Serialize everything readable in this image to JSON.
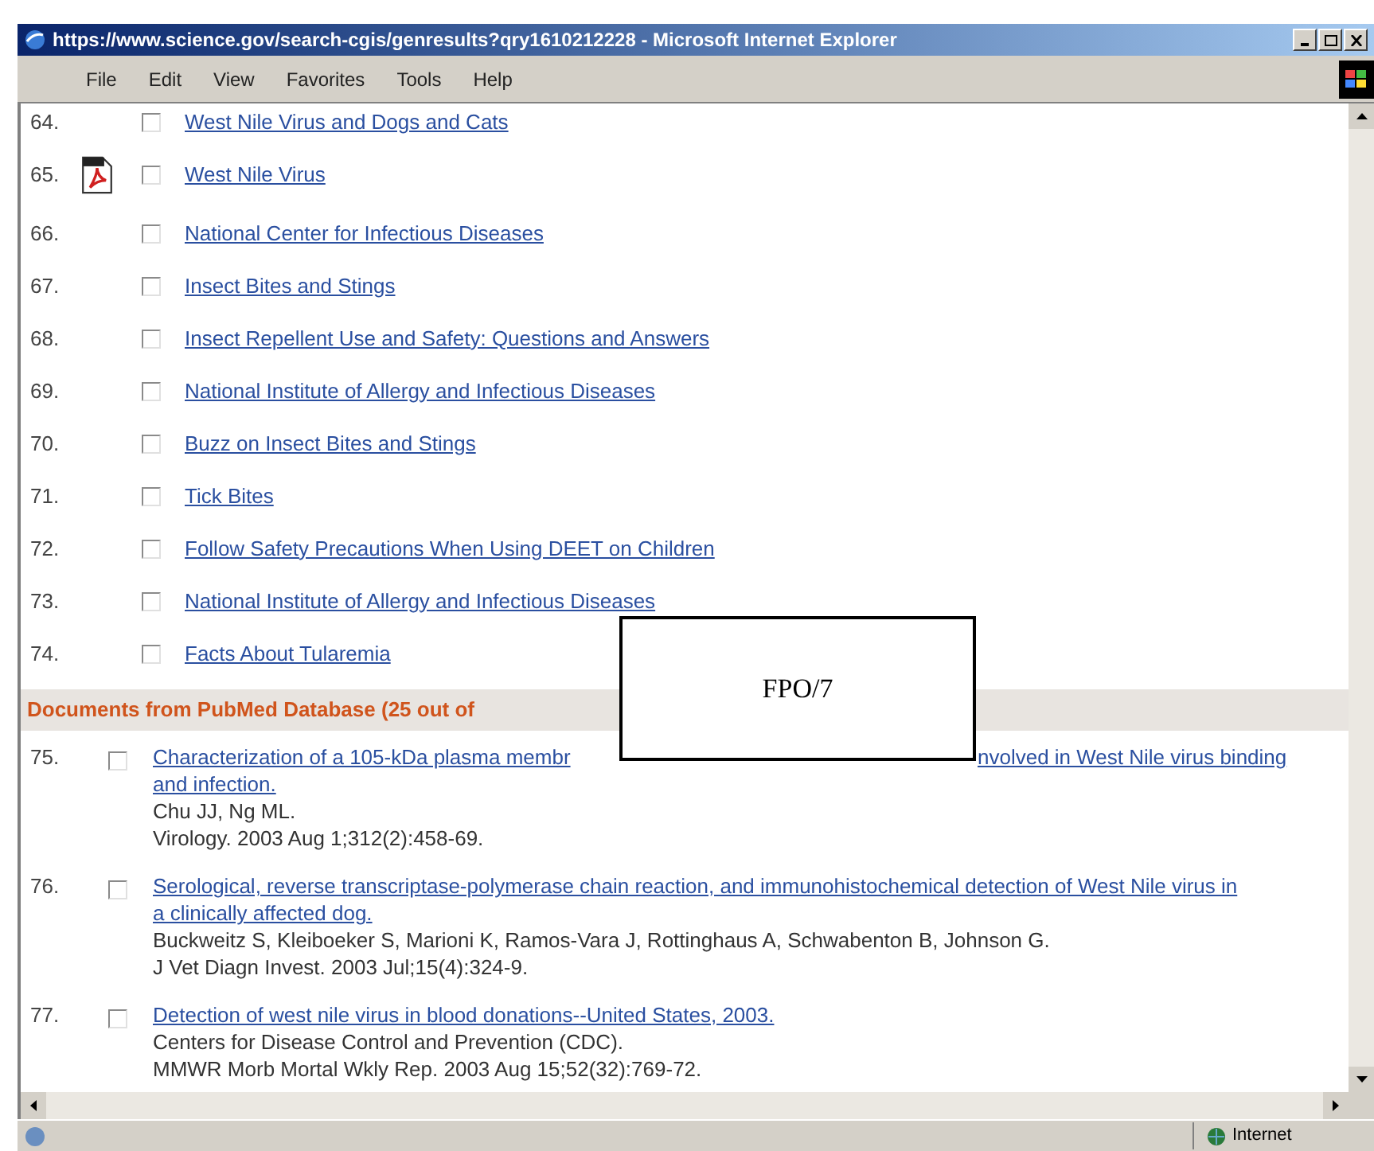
{
  "window": {
    "title": "https://www.science.gov/search-cgis/genresults?qry1610212228 - Microsoft Internet Explorer"
  },
  "menu": [
    "File",
    "Edit",
    "View",
    "Favorites",
    "Tools",
    "Help"
  ],
  "results": [
    {
      "number": "64.",
      "kind": "web",
      "title": "West Nile Virus and Dogs and Cats",
      "checked": false
    },
    {
      "number": "65.",
      "kind": "pdf",
      "title": "West Nile Virus",
      "checked": false
    },
    {
      "number": "66.",
      "kind": "web",
      "title": "National Center for Infectious Diseases",
      "checked": false
    },
    {
      "number": "67.",
      "kind": "web",
      "title": "Insect Bites and Stings",
      "checked": false
    },
    {
      "number": "68.",
      "kind": "web",
      "title": "Insect Repellent Use and Safety: Questions and Answers",
      "checked": false
    },
    {
      "number": "69.",
      "kind": "web",
      "title": "National Institute of Allergy and Infectious Diseases",
      "checked": false
    },
    {
      "number": "70.",
      "kind": "web",
      "title": "Buzz on Insect Bites and Stings",
      "checked": false
    },
    {
      "number": "71.",
      "kind": "web",
      "title": "Tick Bites",
      "checked": false
    },
    {
      "number": "72.",
      "kind": "web",
      "title": "Follow Safety Precautions When Using DEET on Children",
      "checked": false
    },
    {
      "number": "73.",
      "kind": "web",
      "title": "National Institute of Allergy and Infectious Diseases",
      "checked": false
    },
    {
      "number": "74.",
      "kind": "web",
      "title": "Facts About Tularemia",
      "checked": false
    }
  ],
  "section_heading": "Documents from PubMed Database (25 out of",
  "overlay_label": "FPO/7",
  "pubmed": [
    {
      "number": "75.",
      "title_parts": [
        "Characterization of a 105-kDa plasma membr",
        "nvolved in West Nile virus binding"
      ],
      "title_line2": "and infection.",
      "authors": "Chu JJ, Ng ML.",
      "citation": "Virology. 2003 Aug 1;312(2):458-69.",
      "checked": false
    },
    {
      "number": "76.",
      "title_parts": [
        "Serological, reverse transcriptase-polymerase chain reaction, and immunohistochemical detection of West Nile virus in"
      ],
      "title_line2": "a clinically affected dog.",
      "authors": "Buckweitz S, Kleiboeker S, Marioni K, Ramos-Vara J, Rottinghaus A, Schwabenton B, Johnson G.",
      "citation": "J Vet Diagn Invest. 2003 Jul;15(4):324-9.",
      "checked": false
    },
    {
      "number": "77.",
      "title_parts": [
        "Detection of west nile virus in blood donations--United States, 2003."
      ],
      "authors": "Centers for Disease Control and Prevention (CDC).",
      "citation": "MMWR Morb Mortal Wkly Rep. 2003 Aug 15;52(32):769-72.",
      "checked": false
    }
  ],
  "status_bar": {
    "zone": "Internet"
  }
}
